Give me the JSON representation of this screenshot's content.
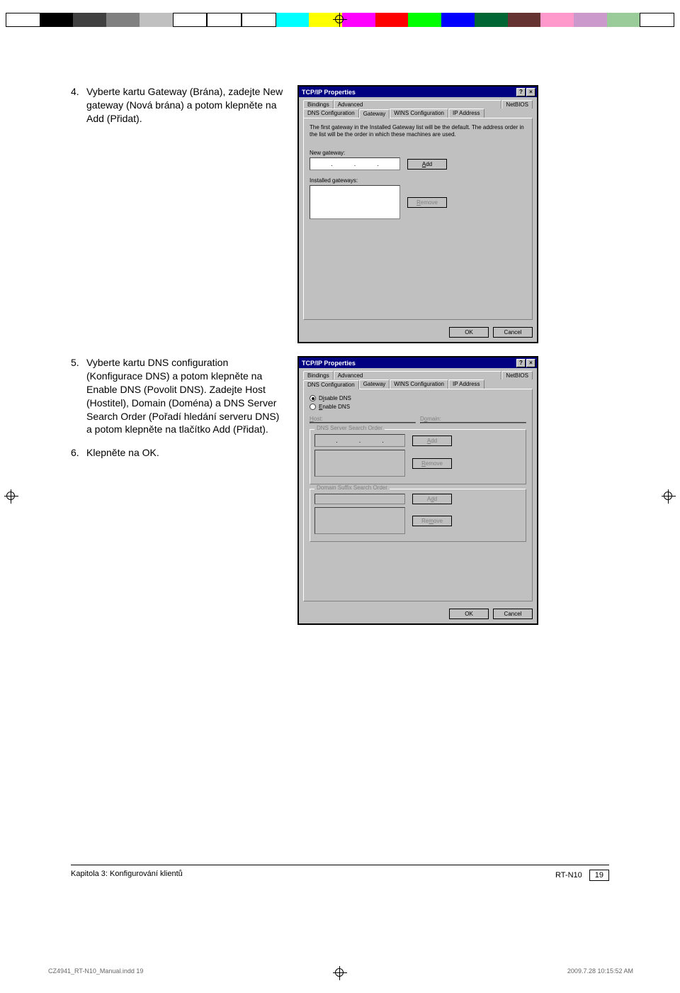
{
  "colors": [
    "#ffffff",
    "#000000",
    "#404040",
    "#808080",
    "#c0c0c0",
    "#00ffff",
    "#ffff00",
    "#ff00ff",
    "#ff0000",
    "#00ff00",
    "#0000ff",
    "#004000",
    "#400000",
    "#ff99cc",
    "#99cc99",
    "#cc99cc"
  ],
  "steps": {
    "s4": {
      "num": "4.",
      "text": "Vyberte kartu Gateway (Brána), zadejte New gateway (Nová brána) a potom klepněte na Add (Přidat)."
    },
    "s5": {
      "num": "5.",
      "text": "Vyberte kartu DNS configuration (Konfigurace DNS) a potom klepněte na Enable DNS (Povolit DNS). Zadejte Host (Hostitel), Domain (Doména) a DNS Server Search Order (Pořadí hledání serveru DNS) a potom klepněte na tlačítko Add (Přidat)."
    },
    "s6": {
      "num": "6.",
      "text": "Klepněte na OK."
    }
  },
  "dialog1": {
    "title": "TCP/IP Properties",
    "help": "?",
    "close": "×",
    "tabs_top": [
      "Bindings",
      "Advanced",
      "NetBIOS"
    ],
    "tabs_bottom": [
      "DNS Configuration",
      "Gateway",
      "WINS Configuration",
      "IP Address"
    ],
    "info": "The first gateway in the Installed Gateway list will be the default. The address order in the list will be the order in which these machines are used.",
    "new_gw_label": "New gateway:",
    "add": "Add",
    "installed_label": "Installed gateways:",
    "remove": "Remove",
    "ok": "OK",
    "cancel": "Cancel"
  },
  "dialog2": {
    "title": "TCP/IP Properties",
    "help": "?",
    "close": "×",
    "tabs_top": [
      "Bindings",
      "Advanced",
      "NetBIOS"
    ],
    "tabs_bottom": [
      "DNS Configuration",
      "Gateway",
      "WINS Configuration",
      "IP Address"
    ],
    "disable": "Disable DNS",
    "enable": "Enable DNS",
    "host": "Host:",
    "domain": "Domain:",
    "search_order": "DNS Server Search Order",
    "suffix_order": "Domain Suffix Search Order",
    "add": "Add",
    "remove": "Remove",
    "ok": "OK",
    "cancel": "Cancel"
  },
  "footer": {
    "chapter": "Kapitola 3: Konfigurování klientů",
    "model": "RT-N10",
    "page": "19"
  },
  "indd": {
    "file": "CZ4941_RT-N10_Manual.indd   19",
    "stamp": "2009.7.28   10:15:52 AM"
  }
}
